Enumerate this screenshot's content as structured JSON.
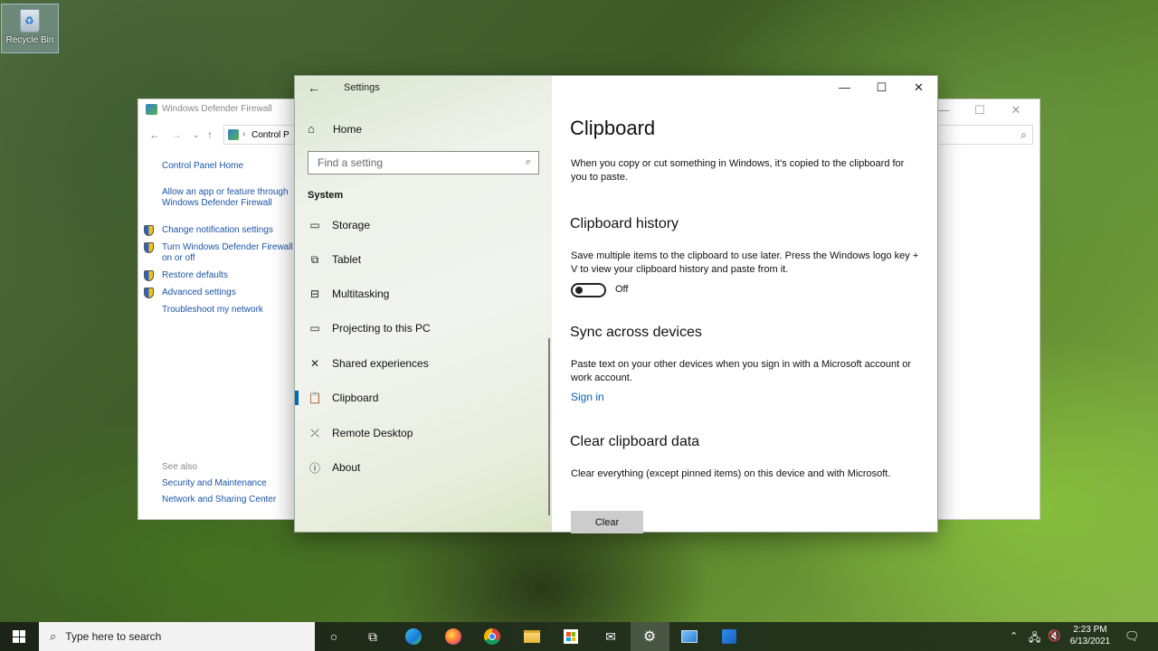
{
  "desktop": {
    "recycle_bin_label": "Recycle Bin"
  },
  "control_panel": {
    "title": "Windows Defender Firewall",
    "address": "Control P",
    "links": [
      "Control Panel Home",
      "Allow an app or feature through Windows Defender Firewall",
      "Change notification settings",
      "Turn Windows Defender Firewall on or off",
      "Restore defaults",
      "Advanced settings",
      "Troubleshoot my network"
    ],
    "see_also_label": "See also",
    "see_also_links": [
      "Security and Maintenance",
      "Network and Sharing Center"
    ]
  },
  "settings": {
    "window_title": "Settings",
    "home_label": "Home",
    "search_placeholder": "Find a setting",
    "section_label": "System",
    "nav_items": [
      {
        "label": "Storage",
        "icon": "storage-icon",
        "selected": false
      },
      {
        "label": "Tablet",
        "icon": "tablet-icon",
        "selected": false
      },
      {
        "label": "Multitasking",
        "icon": "multitasking-icon",
        "selected": false
      },
      {
        "label": "Projecting to this PC",
        "icon": "projecting-icon",
        "selected": false
      },
      {
        "label": "Shared experiences",
        "icon": "shared-experiences-icon",
        "selected": false
      },
      {
        "label": "Clipboard",
        "icon": "clipboard-icon",
        "selected": true
      },
      {
        "label": "Remote Desktop",
        "icon": "remote-desktop-icon",
        "selected": false
      },
      {
        "label": "About",
        "icon": "info-icon",
        "selected": false
      }
    ],
    "accent_color": "#0067c0",
    "page": {
      "title": "Clipboard",
      "intro": "When you copy or cut something in Windows, it's copied to the clipboard for you to paste.",
      "history_heading": "Clipboard history",
      "history_desc": "Save multiple items to the clipboard to use later. Press the Windows logo key + V to view your clipboard history and paste from it.",
      "history_toggle_state": "Off",
      "sync_heading": "Sync across devices",
      "sync_desc": "Paste text on your other devices when you sign in with a Microsoft account or work account.",
      "sign_in_label": "Sign in",
      "clear_heading": "Clear clipboard data",
      "clear_desc": "Clear everything (except pinned items) on this device and with Microsoft.",
      "clear_button_label": "Clear"
    }
  },
  "taskbar": {
    "search_placeholder": "Type here to search",
    "pinned_apps": [
      "cortana-icon",
      "task-view-icon",
      "edge-icon",
      "firefox-icon",
      "chrome-icon",
      "file-explorer-icon",
      "store-icon",
      "mail-icon",
      "settings-icon",
      "control-panel-icon",
      "firewall-icon"
    ],
    "active_app": "settings-icon",
    "time": "2:23 PM",
    "date": "6/13/2021"
  }
}
